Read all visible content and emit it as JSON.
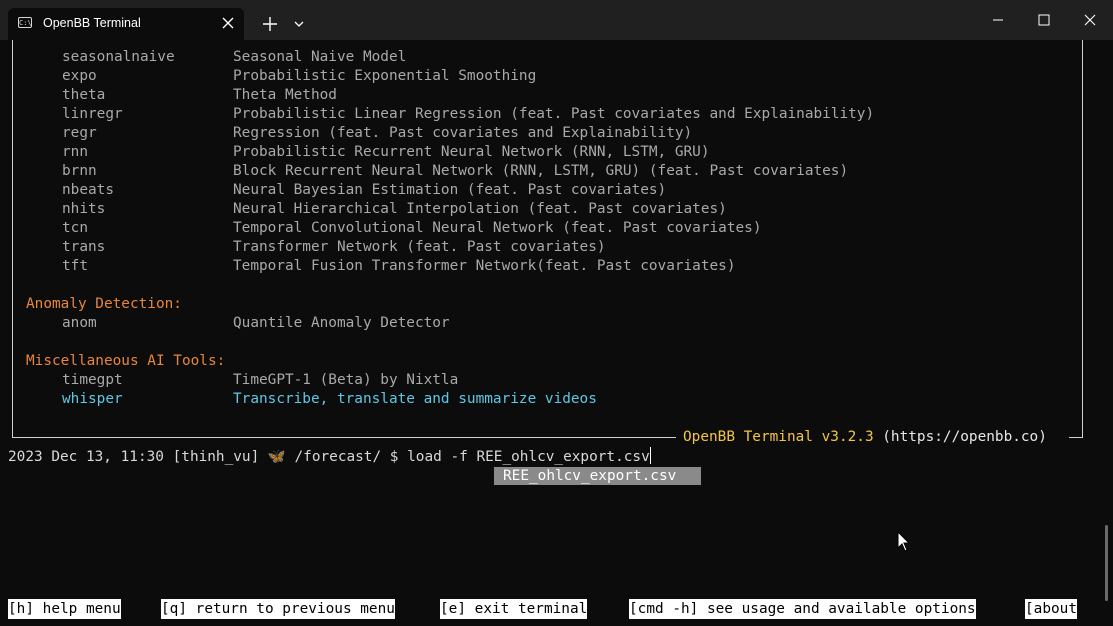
{
  "window": {
    "tab_title": "OpenBB Terminal",
    "icons": [
      "terminal-icon",
      "close-icon",
      "plus-icon",
      "chevron-down-icon",
      "minimize-icon",
      "maximize-icon",
      "close-icon"
    ]
  },
  "models": [
    {
      "cmd": "seasonalnaive",
      "desc": "Seasonal Naive Model"
    },
    {
      "cmd": "expo",
      "desc": "Probabilistic Exponential Smoothing"
    },
    {
      "cmd": "theta",
      "desc": "Theta Method"
    },
    {
      "cmd": "linregr",
      "desc": "Probabilistic Linear Regression (feat. Past covariates and Explainability)"
    },
    {
      "cmd": "regr",
      "desc": "Regression (feat. Past covariates and Explainability)"
    },
    {
      "cmd": "rnn",
      "desc": "Probabilistic Recurrent Neural Network (RNN, LSTM, GRU)"
    },
    {
      "cmd": "brnn",
      "desc": "Block Recurrent Neural Network (RNN, LSTM, GRU) (feat. Past covariates)"
    },
    {
      "cmd": "nbeats",
      "desc": "Neural Bayesian Estimation (feat. Past covariates)"
    },
    {
      "cmd": "nhits",
      "desc": "Neural Hierarchical Interpolation (feat. Past covariates)"
    },
    {
      "cmd": "tcn",
      "desc": "Temporal Convolutional Neural Network (feat. Past covariates)"
    },
    {
      "cmd": "trans",
      "desc": "Transformer Network (feat. Past covariates)"
    },
    {
      "cmd": "tft",
      "desc": "Temporal Fusion Transformer Network(feat. Past covariates)"
    }
  ],
  "anomaly": {
    "heading": "Anomaly Detection:",
    "items": [
      {
        "cmd": "anom",
        "desc": "Quantile Anomaly Detector"
      }
    ]
  },
  "misc": {
    "heading": "Miscellaneous AI Tools:",
    "items": [
      {
        "cmd": "timegpt",
        "desc": "TimeGPT-1 (Beta) by Nixtla"
      },
      {
        "cmd": "whisper",
        "desc": "Transcribe, translate and summarize videos"
      }
    ]
  },
  "frame": {
    "name": "OpenBB Terminal v3.2.3",
    "url": " (https://openbb.co)"
  },
  "prompt": {
    "prefix": "2023 Dec 13, 11:30 [thinh_vu] 🦋 /forecast/ $ ",
    "input": "load -f REE_ohlcv_export.csv"
  },
  "completion": "REE_ohlcv_export.csv",
  "hints": [
    "[h] help menu",
    "[q] return to previous menu",
    "[e] exit terminal",
    "[cmd -h] see usage and available options",
    "[about"
  ],
  "colors": {
    "background": "#0c0c0c",
    "section": "#e8863a",
    "highlight": "#5fc8e6",
    "frame_name": "#f5c542"
  }
}
